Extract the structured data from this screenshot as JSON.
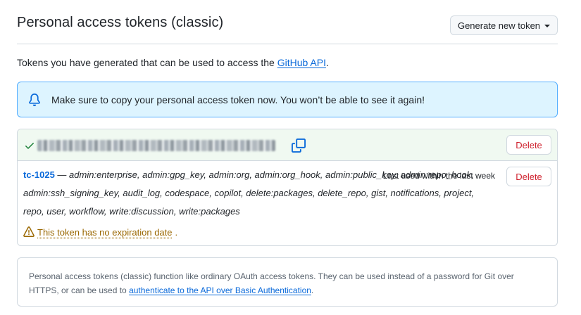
{
  "header": {
    "title": "Personal access tokens (classic)",
    "generate_button": "Generate new token",
    "caret_icon": "triangle-down-icon"
  },
  "intro": {
    "text": "Tokens you have generated that can be used to access the ",
    "link": "GitHub API",
    "suffix": "."
  },
  "flash": {
    "icon": "bell-icon",
    "message": "Make sure to copy your personal access token now. You won’t be able to see it again!"
  },
  "new_token": {
    "check_icon": "check-icon",
    "copy_icon": "copy-icon",
    "delete_label": "Delete"
  },
  "token": {
    "name": "tc-1025",
    "separator": " — ",
    "scopes": "admin:enterprise, admin:gpg_key, admin:org, admin:org_hook, admin:public_key, admin:repo_hook, admin:ssh_signing_key, audit_log, codespace, copilot, delete:packages, delete_repo, gist, notifications, project, repo, user, workflow, write:discussion, write:packages",
    "last_used": "Last used within the last week",
    "delete_label": "Delete",
    "warning_icon": "alert-icon",
    "warning": "This token has no expiration date",
    "warning_suffix": "."
  },
  "note": {
    "text": "Personal access tokens (classic) function like ordinary OAuth access tokens. They can be used instead of a password for Git over HTTPS, or can be used to ",
    "link": "authenticate to the API over Basic Authentication",
    "suffix": "."
  },
  "colors": {
    "accent": "#0969da",
    "danger": "#cf222e",
    "attention": "#9a6700",
    "success": "#1a7f37",
    "flash_bg": "#ddf4ff",
    "flash_border": "#54aeff"
  }
}
